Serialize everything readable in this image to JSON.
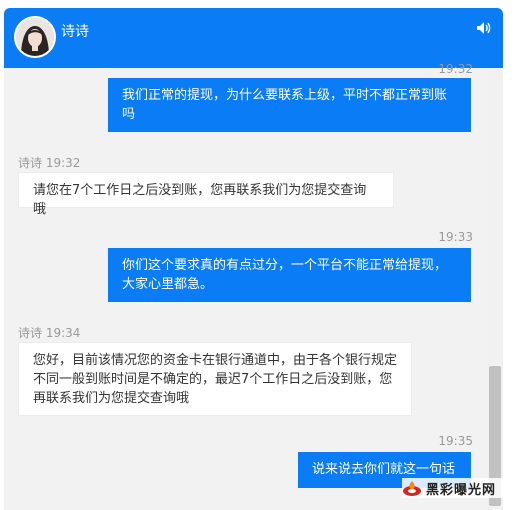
{
  "header": {
    "contact_name": "诗诗",
    "avatar_icon": "avatar-portrait",
    "sound_icon": "speaker-icon",
    "color": "#0a7cf5"
  },
  "messages": [
    {
      "side": "sent",
      "time": "19:32",
      "text": "我们正常的提现，为什么要联系上级，平时不都正常到账吗"
    },
    {
      "side": "received",
      "sender_time": "诗诗 19:32",
      "text": "请您在7个工作日之后没到账，您再联系我们为您提交查询哦"
    },
    {
      "side": "sent",
      "time": "19:33",
      "text": "你们这个要求真的有点过分，一个平台不能正常给提现，大家心里都急。"
    },
    {
      "side": "received",
      "sender_time": "诗诗 19:34",
      "text": "您好，目前该情况您的资金卡在银行通道中，由于各个银行规定不同一般到账时间是不确定的，最迟7个工作日之后没到账，您再联系我们为您提交查询哦"
    },
    {
      "side": "sent",
      "time": "19:35",
      "text": "说来说去你们就这一句话"
    }
  ],
  "watermark": {
    "text": "黑彩曝光网",
    "icon": "flame-logo-icon"
  }
}
